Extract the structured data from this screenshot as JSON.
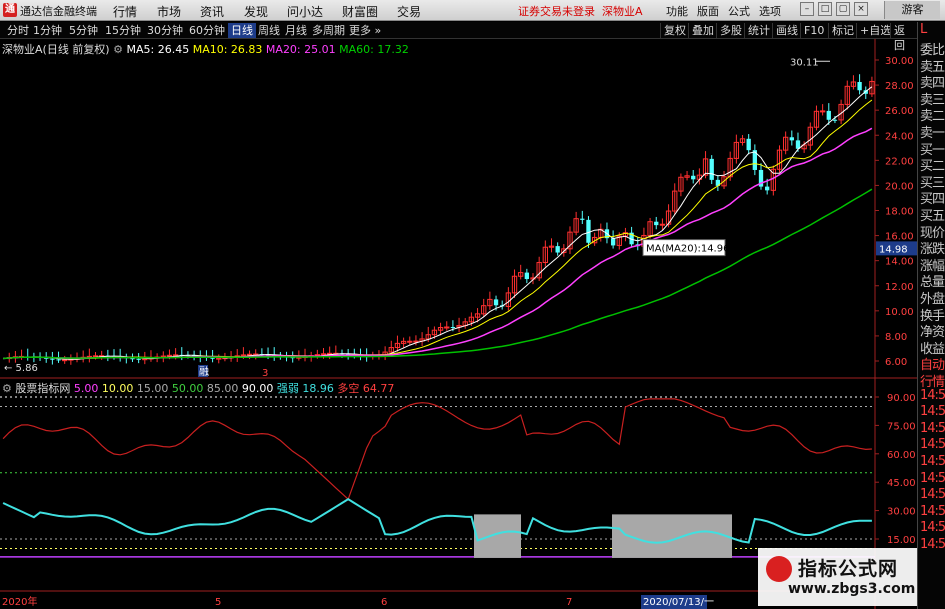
{
  "menubar": {
    "app_title": "通达信金融终端",
    "items": [
      "行情",
      "市场",
      "资讯",
      "发现",
      "问小达",
      "财富圈",
      "交易"
    ],
    "status": "证券交易未登录",
    "stock_name": "深物业A",
    "right_items": [
      "功能",
      "版面",
      "公式",
      "选项"
    ],
    "guest": "游客"
  },
  "toolbar": {
    "periods": [
      "分时",
      "1分钟",
      "5分钟",
      "15分钟",
      "30分钟",
      "60分钟",
      "日线",
      "周线",
      "月线",
      "多周期",
      "更多"
    ],
    "active_period": "日线",
    "right_tabs": [
      "复权",
      "叠加",
      "多股",
      "统计",
      "画线",
      "F10",
      "标记",
      "+自选",
      "返回"
    ]
  },
  "price_legend": {
    "title": "深物业A(日线 前复权)",
    "ma5": "MA5: 26.45",
    "ma10": "MA10: 26.83",
    "ma20": "MA20: 25.01",
    "ma60": "MA60: 17.32"
  },
  "price_axis": {
    "ticks": [
      "30.00",
      "28.00",
      "26.00",
      "24.00",
      "22.00",
      "20.00",
      "18.00",
      "16.00",
      "14.00",
      "12.00",
      "10.00",
      "8.00",
      "6.00"
    ],
    "current_price": "14.98",
    "high_label": "30.11",
    "low_label": "5.86",
    "tooltip": "MA(MA20):14.96"
  },
  "event_markers": [
    "融",
    "3"
  ],
  "indicator_legend": {
    "title": "股票指标网",
    "levels": [
      "5.00",
      "10.00",
      "15.00",
      "50.00",
      "85.00",
      "90.00"
    ],
    "mode": "强弱",
    "value": "18.96",
    "short_label": "多空",
    "short_value": "64.77"
  },
  "indicator_axis": {
    "ticks": [
      "90.00",
      "75.00",
      "60.00",
      "45.00",
      "30.00",
      "15.00"
    ]
  },
  "date_axis": {
    "labels": [
      "2020年",
      "5",
      "6",
      "7"
    ],
    "cursor_date": "2020/07/13/一"
  },
  "sidebar": {
    "items": [
      "委比",
      "卖五",
      "卖四",
      "卖三",
      "卖二",
      "卖一",
      "买一",
      "买二",
      "买三",
      "买四",
      "买五",
      "现价",
      "涨跌",
      "涨幅",
      "总量",
      "外盘",
      "换手",
      "净资",
      "收益",
      "自动",
      "行情",
      "14:5",
      "14:5",
      "14:5",
      "14:5",
      "14:5",
      "14:5",
      "14:5",
      "14:5",
      "14:5",
      "14:5"
    ],
    "top_letter": "L"
  },
  "watermark": {
    "title": "指标公式网",
    "url": "www.zbgs3.com"
  },
  "colors": {
    "up": "#ff3030",
    "down": "#54ffff",
    "ma5": "#ffffff",
    "ma10": "#ffff00",
    "ma20": "#ff40ff",
    "ma60": "#00c000",
    "strength": "#c82020",
    "momentum": "#40e0e0"
  }
}
